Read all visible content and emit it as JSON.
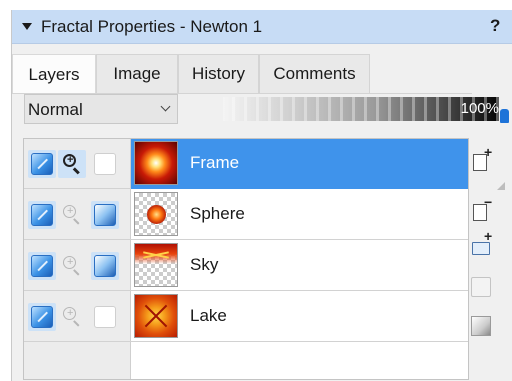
{
  "header": {
    "title": "Fractal Properties - Newton 1",
    "help_label": "?"
  },
  "tabs": [
    {
      "label": "Layers",
      "active": true
    },
    {
      "label": "Image",
      "active": false
    },
    {
      "label": "History",
      "active": false
    },
    {
      "label": "Comments",
      "active": false
    }
  ],
  "blend_mode": {
    "selected": "Normal"
  },
  "opacity": {
    "label": "100%",
    "value": 100
  },
  "layers": [
    {
      "name": "Frame",
      "selected": true,
      "visible": true,
      "zoom_active": true,
      "mask": false
    },
    {
      "name": "Sphere",
      "selected": false,
      "visible": true,
      "zoom_active": false,
      "mask": true
    },
    {
      "name": "Sky",
      "selected": false,
      "visible": true,
      "zoom_active": false,
      "mask": true
    },
    {
      "name": "Lake",
      "selected": false,
      "visible": true,
      "zoom_active": false,
      "mask": false
    }
  ],
  "side_toolbar": [
    {
      "name": "add-layer",
      "sign": "+"
    },
    {
      "name": "delete-layer",
      "sign": "−"
    },
    {
      "name": "add-group",
      "sign": "+"
    },
    {
      "name": "blank-layer",
      "sign": ""
    },
    {
      "name": "gradient-layer",
      "sign": ""
    }
  ],
  "colors": {
    "title_bar": "#c7dcf5",
    "selection": "#3f93eb",
    "panel": "#f0f0f0"
  }
}
